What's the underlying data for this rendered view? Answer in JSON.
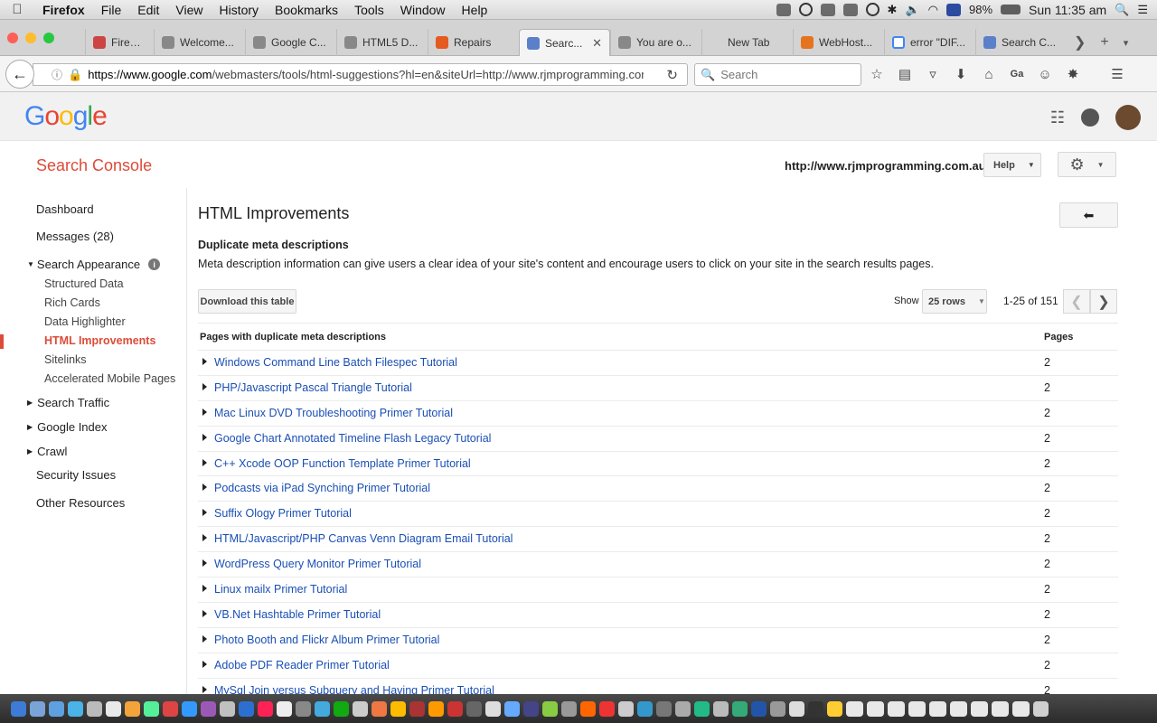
{
  "menubar": {
    "app": "Firefox",
    "items": [
      "File",
      "Edit",
      "View",
      "History",
      "Bookmarks",
      "Tools",
      "Window",
      "Help"
    ],
    "battery": "98%",
    "clock": "Sun 11:35 am"
  },
  "tabs": [
    {
      "label": "Firebug"
    },
    {
      "label": "Welcome..."
    },
    {
      "label": "Google C..."
    },
    {
      "label": "HTML5 D..."
    },
    {
      "label": "Repairs"
    },
    {
      "label": "Searc...",
      "active": true
    },
    {
      "label": "You are o..."
    },
    {
      "label": "New Tab"
    },
    {
      "label": "WebHost..."
    },
    {
      "label": "error \"DIF..."
    },
    {
      "label": "Search C..."
    }
  ],
  "nav": {
    "url_host": "https://www.google.com",
    "url_path": "/webmasters/tools/html-suggestions?hl=en&siteUrl=http://www.rjmprogramming.com.a",
    "search_placeholder": "Search",
    "ext_label": "Ga"
  },
  "google": {
    "logo": "Google"
  },
  "console": {
    "title": "Search Console",
    "site": "http://www.rjmprogramming.com.au/",
    "help": "Help"
  },
  "sidebar": {
    "dashboard": "Dashboard",
    "messages": "Messages (28)",
    "search_appearance": "Search Appearance",
    "sub": [
      "Structured Data",
      "Rich Cards",
      "Data Highlighter",
      "HTML Improvements",
      "Sitelinks",
      "Accelerated Mobile Pages"
    ],
    "search_traffic": "Search Traffic",
    "google_index": "Google Index",
    "crawl": "Crawl",
    "security": "Security Issues",
    "other": "Other Resources"
  },
  "main": {
    "title": "HTML Improvements",
    "subheading": "Duplicate meta descriptions",
    "description": "Meta description information can give users a clear idea of your site's content and encourage users to click on your site in the search results pages.",
    "download": "Download this table",
    "show_label": "Show",
    "rows_value": "25 rows",
    "range": "1-25 of 151",
    "col_pages_with": "Pages with duplicate meta descriptions",
    "col_pages": "Pages",
    "rows": [
      {
        "title": "Windows Command Line Batch Filespec Tutorial",
        "pages": "2"
      },
      {
        "title": "PHP/Javascript Pascal Triangle Tutorial",
        "pages": "2"
      },
      {
        "title": "Mac Linux DVD Troubleshooting Primer Tutorial",
        "pages": "2"
      },
      {
        "title": "Google Chart Annotated Timeline Flash Legacy Tutorial",
        "pages": "2"
      },
      {
        "title": "C++ Xcode OOP Function Template Primer Tutorial",
        "pages": "2"
      },
      {
        "title": "Podcasts via iPad Synching Primer Tutorial",
        "pages": "2"
      },
      {
        "title": "Suffix Ology Primer Tutorial",
        "pages": "2"
      },
      {
        "title": "HTML/Javascript/PHP Canvas Venn Diagram Email Tutorial",
        "pages": "2"
      },
      {
        "title": "WordPress Query Monitor Primer Tutorial",
        "pages": "2"
      },
      {
        "title": "Linux mailx Primer Tutorial",
        "pages": "2"
      },
      {
        "title": "VB.Net Hashtable Primer Tutorial",
        "pages": "2"
      },
      {
        "title": "Photo Booth and Flickr Album Primer Tutorial",
        "pages": "2"
      },
      {
        "title": "Adobe PDF Reader Primer Tutorial",
        "pages": "2"
      },
      {
        "title": "MySql Join versus Subquery and Having Primer Tutorial",
        "pages": "2"
      }
    ]
  }
}
